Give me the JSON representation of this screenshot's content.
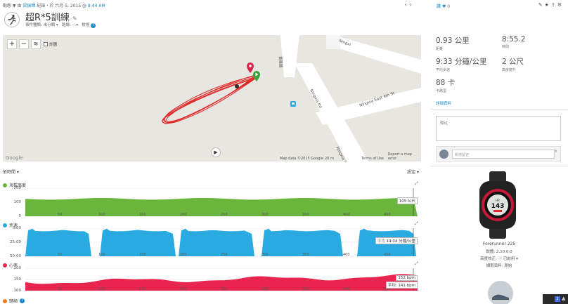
{
  "header": {
    "breadcrumb_prefix": "動態",
    "breadcrumb_arrow": "▼",
    "breadcrumb_by": "由",
    "author": "梁振輝",
    "breadcrumb_suffix": "紀錄・於 六月 5, 2015 @",
    "time": "8:44 AM",
    "title": "超R*5訓練",
    "event_type": "事件種類: 未分類 ▾",
    "course": "路線: -- ▾",
    "privacy": "檢視",
    "help": "?"
  },
  "map": {
    "attribution": "Map data ©2015 Google",
    "scale": "20 m",
    "terms": "Terms of Use",
    "report": "Report a map error",
    "google": "Google",
    "layers_label": "計圖",
    "streets": [
      "景華路",
      "Ningxia Rd",
      "Ningxia East 4th St",
      "Ningxi"
    ]
  },
  "charts_header": {
    "left": "依時間 ▾",
    "right": "設定 ▾"
  },
  "charts": [
    {
      "label": "海拔高度",
      "color": "#6ab53b",
      "yticks": [
        "200",
        "100",
        "0"
      ],
      "xticks": [
        "50",
        "100",
        "150",
        "200",
        "250",
        "300",
        "350",
        "400",
        "450"
      ],
      "tooltip": "105 公尺"
    },
    {
      "label": "步速",
      "color": "#29abe2",
      "yticks": [
        "0:00",
        "25:00",
        "50:00"
      ],
      "xticks": [
        "50",
        "100",
        "150",
        "200",
        "250",
        "300",
        "350",
        "400",
        "450"
      ],
      "tooltip": "14:04 分鐘/公里",
      "avg_label": "平均"
    },
    {
      "label": "心率",
      "color": "#e8254f",
      "yticks": [
        "200",
        "150",
        "100"
      ],
      "xticks": [
        "50",
        "100",
        "150",
        "200",
        "250",
        "300",
        "350",
        "400",
        "450"
      ],
      "tooltip": "152 bpm",
      "avg_label": "平均: 141 bpm"
    }
  ],
  "fourth_chart_label": "踏頻",
  "sidebar": {
    "kudos_count": "0",
    "kudos_label": "讚",
    "stats": [
      {
        "value": "0.93 公里",
        "label": "距離"
      },
      {
        "value": "8:55.2",
        "label": "時間"
      },
      {
        "value": "9:33 分鐘/公里",
        "label": "平均步速"
      },
      {
        "value": "2 公尺",
        "label": "高度爬升"
      },
      {
        "value": "88 卡",
        "label": "卡路里"
      }
    ],
    "more_link": "詳細資料",
    "notes_placeholder": "備註",
    "comment_placeholder": "新增留言",
    "device_name": "Forerunner 225",
    "software": "軟體: 2.10.0.0",
    "elevation_correction": "高度校正: ⓘ 已啟用 ▾",
    "data_source": "擷取資料: 原始"
  }
}
